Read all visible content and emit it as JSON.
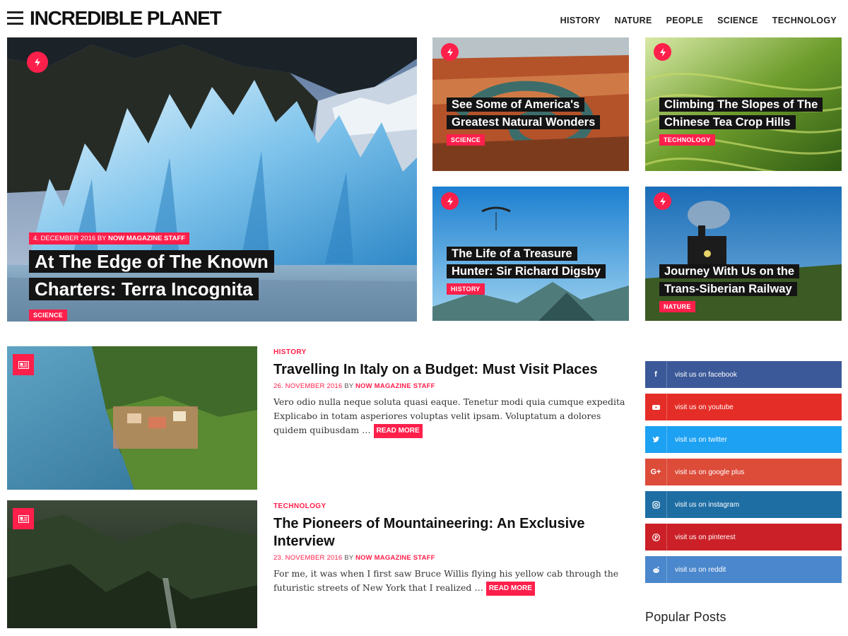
{
  "header": {
    "logo": "INCREDIBLE PLANET",
    "nav": [
      "HISTORY",
      "NATURE",
      "PEOPLE",
      "SCIENCE",
      "TECHNOLOGY"
    ]
  },
  "featured": {
    "main": {
      "date": "4. DECEMBER 2016",
      "by": "BY",
      "author": "NOW MAGAZINE STAFF",
      "title": "At The Edge of The Known Charters: Terra Incognita",
      "category": "SCIENCE"
    },
    "tiles": [
      {
        "title": "See Some of America's Greatest Natural Wonders",
        "category": "SCIENCE"
      },
      {
        "title": "Climbing The Slopes of The Chinese Tea Crop Hills",
        "category": "TECHNOLOGY"
      },
      {
        "title": "The Life of a Treasure Hunter: Sir Richard Digsby",
        "category": "HISTORY"
      },
      {
        "title": "Journey With Us on the Trans-Siberian Railway",
        "category": "NATURE"
      }
    ]
  },
  "articles": [
    {
      "category": "HISTORY",
      "title": "Travelling In Italy on a Budget: Must Visit Places",
      "date": "26. NOVEMBER 2016",
      "by": "BY",
      "author": "NOW MAGAZINE STAFF",
      "excerpt": "Vero odio nulla neque soluta quasi eaque. Tenetur modi quia cumque expedita Explicabo in totam asperiores voluptas velit ipsam. Voluptatum a dolores quidem quibusdam …",
      "read_more": "READ MORE"
    },
    {
      "category": "TECHNOLOGY",
      "title": "The Pioneers of Mountaineering: An Exclusive Interview",
      "date": "23. NOVEMBER 2016",
      "by": "BY",
      "author": "NOW MAGAZINE STAFF",
      "excerpt": "For me, it was when I first saw Bruce Willis flying his yellow cab through the futuristic streets of New York that I realized …",
      "read_more": "READ MORE"
    }
  ],
  "social": [
    {
      "label": "visit us on facebook",
      "icon": "facebook-icon",
      "color": "#3b5998"
    },
    {
      "label": "visit us on youtube",
      "icon": "youtube-icon",
      "color": "#e52d27"
    },
    {
      "label": "visit us on twitter",
      "icon": "twitter-icon",
      "color": "#1da1f2"
    },
    {
      "label": "visit us on google plus",
      "icon": "google-plus-icon",
      "color": "#dd4b39"
    },
    {
      "label": "visit us on instagram",
      "icon": "instagram-icon",
      "color": "#1e6ea4"
    },
    {
      "label": "visit us on pinterest",
      "icon": "pinterest-icon",
      "color": "#cb2027"
    },
    {
      "label": "visit us on reddit",
      "icon": "reddit-icon",
      "color": "#4a87cc"
    }
  ],
  "sidebar": {
    "popular_heading": "Popular Posts"
  },
  "colors": {
    "accent": "#ff1f4b",
    "caption_bg": "#141414"
  }
}
